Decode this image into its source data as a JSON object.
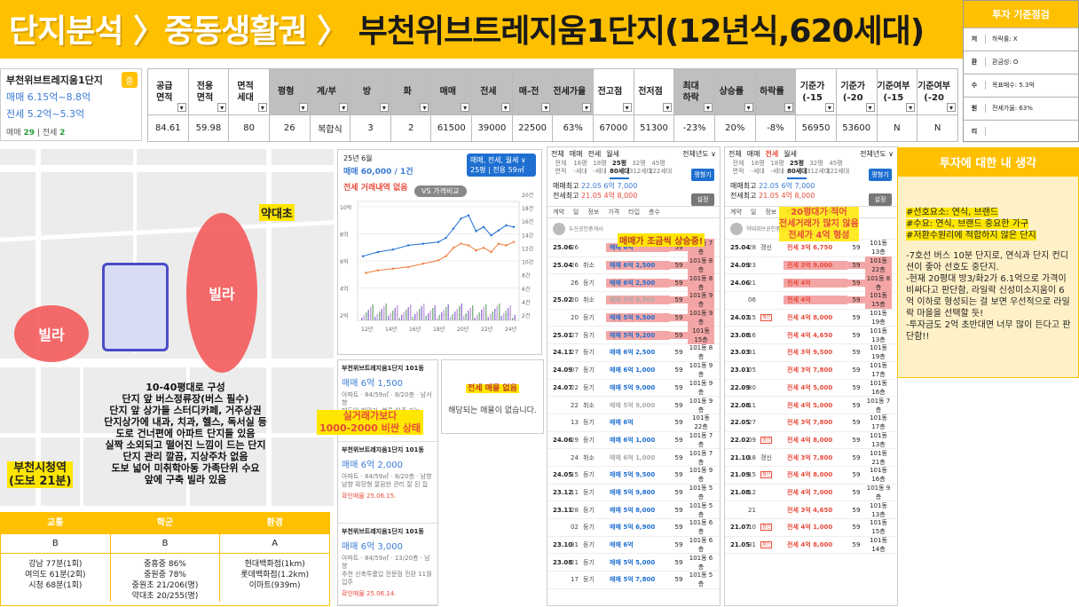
{
  "header": {
    "title_part1": "단지분석 〉중동생활권 〉",
    "title_part2": "부천위브트레지움1단지(12년식,620세대)"
  },
  "criteria": {
    "title": "투자 기준점검",
    "rows": [
      {
        "k": "저",
        "v": "하락률: X"
      },
      {
        "k": "환",
        "v": "환금성: O"
      },
      {
        "k": "수",
        "v": "목표매수: 5.3억"
      },
      {
        "k": "원",
        "v": "전세가율: 63%"
      },
      {
        "k": "리",
        "v": ""
      }
    ]
  },
  "complex_info": {
    "name": "부천위브트레지움1단지",
    "tag": "중",
    "sale_range": "매매 6.15억~8.8억",
    "jeonse_range": "전세 5.2억~5.3억",
    "sale_label": "매매",
    "sale_count": "29",
    "jeonse_label": "전세",
    "jeonse_count": "2"
  },
  "table": {
    "headers": [
      "공급\n면적",
      "전용\n면적",
      "면적\n세대수",
      "평형",
      "계/복",
      "방",
      "화",
      "매매",
      "전세",
      "매-전",
      "전세가율",
      "전고점",
      "전저점",
      "최대\n하락률",
      "상승률",
      "하락률",
      "기준가\n(-15%)",
      "기준가\n(-20%)",
      "기준여부\n(-15%)",
      "기준여부\n(-20%)"
    ],
    "header_display": [
      "공급\n면적",
      "전용\n면적",
      "면적\n세대",
      "평형",
      "계/부",
      "방",
      "화",
      "매매",
      "전세",
      "매-전",
      "전세가율",
      "전고점",
      "전저점",
      "최대\n하락",
      "상승률",
      "하락률",
      "기준가\n(-15",
      "기준가\n(-20",
      "기준여부\n(-15",
      "기준여부\n(-20"
    ],
    "gray": [
      false,
      false,
      false,
      true,
      true,
      true,
      true,
      true,
      true,
      true,
      true,
      false,
      false,
      true,
      true,
      true,
      false,
      false,
      false,
      false
    ],
    "values": [
      "84.61",
      "59.98",
      "80",
      "26",
      "복합식",
      "3",
      "2",
      "61500",
      "39000",
      "22500",
      "63%",
      "67000",
      "51300",
      "-23%",
      "20%",
      "-8%",
      "56950",
      "53600",
      "N",
      "N"
    ]
  },
  "map": {
    "label_school": "약대초",
    "villa1": "빌라",
    "villa2": "빌라",
    "station": "부천시청역\n(도보 21분)",
    "notes": [
      "10-40평대로 구성",
      "단지 앞 버스정류장(버스 필수)",
      "단지 앞 상가들 스터디카페, 거주상권",
      "단지상가에 내과, 치과, 헬스, 독서실 등",
      "도로 건너편에 아파트 단지들 있음",
      "실짝 소외되고 떨어진 느낌이 드는 단지",
      "단지 관리 깔끔, 지상주차 없음",
      "도보 넓어 미취학아동 가족단위 수요",
      "앞에 구축 빌라 있음"
    ]
  },
  "grades": {
    "headers": [
      "교통",
      "학군",
      "환경"
    ],
    "grades": [
      "B",
      "B",
      "A"
    ],
    "details": [
      [
        "강남 77분(1회)",
        "여의도 61분(2회)",
        "시청 68분(1회)"
      ],
      [
        "중흥중 86%",
        "중원중 78%",
        "중원초 21/206(명)",
        "약대초 20/255(명)"
      ],
      [
        "현대백화점(1km)",
        "롯데백화점(1.2km)",
        "이마트(939m)"
      ]
    ]
  },
  "chart": {
    "date": "25년 6월",
    "price": "매매 60,000 / 1건",
    "no_jeonse": "전세 거래내역 없음",
    "badge_line1": "매매, 전세, 월세 ∨",
    "badge_line2": "25평 | 전용 59㎡",
    "vs": "VS 가격비교",
    "x_ticks": [
      "12년",
      "14년",
      "16년",
      "18년",
      "20년",
      "22년",
      "24년"
    ],
    "y_ticks": [
      "10억",
      "8억",
      "6억",
      "4억",
      "2억"
    ],
    "right_ticks": [
      "20건",
      "18건",
      "16건",
      "14건",
      "12건",
      "10건",
      "8건",
      "6건",
      "4건",
      "2건"
    ]
  },
  "listings": [
    {
      "title": "부천위브트레지움1단지 101동",
      "price": "매매 6억 1,500",
      "info": "아파트 · 84/59㎡ · 8/20층 · 남서향",
      "desc": "매도인 희망가, 빠른 입주 가능",
      "date": "확인매물 25.06.15."
    },
    {
      "title": "부천위브트레지움1단지 101동",
      "price": "매매 6억 2,000",
      "info": "아파트 · 84/59㎡ · 8/20층 · 남향",
      "desc": "남향 확장형 깔끔한 관리 잘 된 집",
      "date": "확인매물 25.06.15."
    },
    {
      "title": "부천위브트레지움1단지 101동",
      "price": "매매 6억 3,000",
      "info": "아파트 · 84/59㎡ · 13/20층 · 남향",
      "desc": "추천 신축투룸입 전문점 전환 11월 입주",
      "date": "확인매물 25.06.14."
    }
  ],
  "annotations": {
    "gap": "실거래가보다\n1000-2000 비싼 상태",
    "empty_title": "전세 매물 없음",
    "empty_desc": "해당되는 매물이 없습니다.",
    "rise": "매매가 조금씩 상승중!",
    "jeonse_note": "20평대가 적어\n전세거래가 많지 않음\n전세가 4억 형성"
  },
  "panel1": {
    "tabs": [
      "전체",
      "매매",
      "전세",
      "월세"
    ],
    "tabs_right": "전체년도 ∨",
    "sizes": [
      "전체\n면적",
      "16평\n-세대",
      "18평\n-세대",
      "25평\n80세대",
      "32평\n312세대",
      "45평\n122세대"
    ],
    "btn1": "평형기",
    "btn2": "설정",
    "summary1_a": "매매최고",
    "summary1_b": "22.05 6억 7,000",
    "summary2_a": "전세최고",
    "summary2_b": "21.05 4억 8,000",
    "cols": [
      "계약",
      "일",
      "정보",
      "가격",
      "타입",
      "층수"
    ],
    "agent": "두산공인중개사",
    "rows": [
      [
        "25.06",
        "26",
        "",
        "매매 6억",
        "59",
        "101동 7층",
        "m",
        1
      ],
      [
        "25.04",
        "26",
        "취소",
        "매매 6억 2,500",
        "59",
        "101동 8층",
        "m",
        1
      ],
      [
        "",
        "26",
        "등기",
        "매매 6억 2,500",
        "59",
        "101동 8층",
        "m",
        1
      ],
      [
        "25.02",
        "20",
        "취소",
        "매매 5억 9,500",
        "59",
        "101동 9층",
        "g",
        1
      ],
      [
        "",
        "20",
        "등기",
        "매매 5억 9,500",
        "59",
        "101동 9층",
        "m",
        1
      ],
      [
        "25.01",
        "27",
        "등기",
        "매매 5억 9,200",
        "59",
        "101동 15층",
        "m",
        1
      ],
      [
        "24.11",
        "27",
        "등기",
        "매매 6억 2,500",
        "59",
        "101동 8층",
        "m",
        0
      ],
      [
        "24.09",
        "07",
        "등기",
        "매매 6억 1,000",
        "59",
        "101동 9층",
        "m",
        0
      ],
      [
        "24.07",
        "22",
        "등기",
        "매매 5억 9,000",
        "59",
        "101동 9층",
        "m",
        0
      ],
      [
        "",
        "22",
        "취소",
        "매매 5억 9,000",
        "59",
        "101동 9층",
        "g",
        0
      ],
      [
        "",
        "13",
        "등기",
        "매매 6억",
        "59",
        "101동 22층",
        "m",
        0
      ],
      [
        "24.06",
        "29",
        "등기",
        "매매 6억 1,000",
        "59",
        "101동 7층",
        "m",
        0
      ],
      [
        "",
        "24",
        "취소",
        "매매 6억 1,000",
        "59",
        "101동 7층",
        "g",
        0
      ],
      [
        "24.05",
        "15",
        "등기",
        "매매 5억 9,500",
        "59",
        "101동 9층",
        "m",
        0
      ],
      [
        "23.12",
        "11",
        "등기",
        "매매 5억 9,800",
        "59",
        "101동 5층",
        "m",
        0
      ],
      [
        "23.11",
        "28",
        "등기",
        "매매 5억 8,000",
        "59",
        "101동 5층",
        "m",
        0
      ],
      [
        "",
        "02",
        "등기",
        "매매 5억 6,900",
        "59",
        "101동 6층",
        "m",
        0
      ],
      [
        "23.10",
        "31",
        "등기",
        "매매 6억",
        "59",
        "101동 6층",
        "m",
        0
      ],
      [
        "23.08",
        "21",
        "등기",
        "매매 5억 5,000",
        "59",
        "101동 6층",
        "m",
        0
      ],
      [
        "",
        "17",
        "등기",
        "매매 5억 7,800",
        "59",
        "101동 5층",
        "m",
        0
      ]
    ]
  },
  "panel2": {
    "tabs": [
      "전체",
      "매매",
      "전세",
      "월세"
    ],
    "tabs_right": "전체년도 ∨",
    "sizes": [
      "전체\n면적",
      "16평\n-세대",
      "18평\n-세대",
      "25평\n80세대",
      "32평\n312세대",
      "45평\n122세대"
    ],
    "btn1": "평형기",
    "btn2": "설정",
    "summary1_a": "매매최고",
    "summary1_b": "22.05 6억 7,000",
    "summary2_a": "전세최고",
    "summary2_b": "21.05 4억 8,000",
    "cols": [
      "계약",
      "일",
      "정보",
      "가격",
      "타입",
      "층수"
    ],
    "agent": "약대위브공인중개사",
    "renewal": "갱신",
    "rows": [
      [
        "25.04",
        "28",
        "갱신",
        "전세 3억 6,750",
        "59",
        "101동 13층",
        "j",
        0,
        0
      ],
      [
        "24.09",
        "23",
        "",
        "전세 3억 9,000",
        "59",
        "101동 22층",
        "j",
        1,
        0
      ],
      [
        "24.06",
        "21",
        "",
        "전세 4억",
        "59",
        "101동 8층",
        "j",
        1,
        0
      ],
      [
        "",
        "06",
        "",
        "전세 4억",
        "59",
        "101동 15층",
        "j",
        1,
        0
      ],
      [
        "24.03",
        "15",
        "",
        "전세 4억 8,000",
        "59",
        "101동 19층",
        "j",
        0,
        1
      ],
      [
        "23.08",
        "16",
        "",
        "전세 4억 4,650",
        "59",
        "101동 13층",
        "j",
        0,
        0
      ],
      [
        "23.03",
        "31",
        "",
        "전세 3억 9,500",
        "59",
        "101동 19층",
        "j",
        0,
        0
      ],
      [
        "23.01",
        "05",
        "",
        "전세 3억 7,800",
        "59",
        "101동 17층",
        "j",
        0,
        0
      ],
      [
        "22.09",
        "30",
        "",
        "전세 4억 5,000",
        "59",
        "101동 16층",
        "j",
        0,
        0
      ],
      [
        "22.08",
        "11",
        "",
        "전세 4억 5,000",
        "59",
        "101동 7층",
        "j",
        0,
        0
      ],
      [
        "22.05",
        "27",
        "",
        "전세 3억 7,800",
        "59",
        "101동 17층",
        "j",
        0,
        0
      ],
      [
        "22.02",
        "09",
        "",
        "전세 4억 8,000",
        "59",
        "101동 13층",
        "j",
        0,
        1
      ],
      [
        "21.10",
        "18",
        "갱신",
        "전세 3억 7,800",
        "59",
        "101동 21층",
        "j",
        0,
        0
      ],
      [
        "21.09",
        "15",
        "",
        "전세 4억 8,000",
        "59",
        "101동 16층",
        "j",
        0,
        1
      ],
      [
        "21.08",
        "12",
        "",
        "전세 4억 7,000",
        "59",
        "101동 9층",
        "j",
        0,
        0
      ],
      [
        "",
        "21",
        "",
        "전세 3억 4,650",
        "59",
        "101동 13층",
        "j",
        0,
        0
      ],
      [
        "21.07",
        "10",
        "",
        "전세 4억 1,000",
        "59",
        "101동 15층",
        "j",
        0,
        1
      ],
      [
        "21.05",
        "31",
        "",
        "전세 4억 8,000",
        "59",
        "101동 14층",
        "j",
        0,
        1
      ]
    ]
  },
  "opinion": {
    "title": "투자에 대한 내 생각",
    "tags": [
      "#선호요소: 연식, 브랜드",
      "#수요: 연식, 브랜드 중요한 가구",
      "#저환수원리에 적합하지 않은 단지"
    ],
    "body": [
      "-7호선 버스 10분 단지로, 연식과 단지 컨디션이 좋아 선호도 중단지.",
      "-현재 20평대 방3/화2가 6.1억으로 가격이 비싸다고 판단함, 라일락 신성미소지움이 6억 이하로 형성되는 걸 보면 우선적으로 라일락 마을을 선택할 듯!",
      "-투자금도 2억 초반대면 너무 많이 든다고 판단함!!"
    ]
  },
  "colors": {
    "accent": "#ffc000",
    "sale": "#1f6fd1",
    "jeonse": "#e74c3c",
    "highlight": "#f4a6a6"
  }
}
